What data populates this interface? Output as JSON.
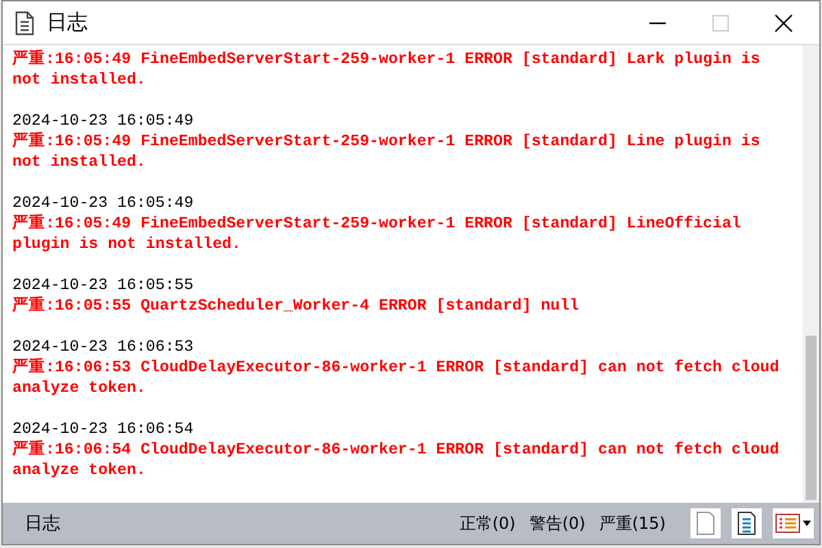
{
  "window": {
    "title": "日志"
  },
  "entries": [
    {
      "kind": "error",
      "message": "严重:16:05:49 FineEmbedServerStart-259-worker-1 ERROR [standard] Lark plugin is not installed."
    },
    {
      "date": "2024-10-23 16:05:49",
      "kind": "error",
      "message": "严重:16:05:49 FineEmbedServerStart-259-worker-1 ERROR [standard] Line plugin is not installed."
    },
    {
      "date": "2024-10-23 16:05:49",
      "kind": "error",
      "message": "严重:16:05:49 FineEmbedServerStart-259-worker-1 ERROR [standard] LineOfficial plugin is not installed."
    },
    {
      "date": "2024-10-23 16:05:55",
      "kind": "error",
      "message": "严重:16:05:55 QuartzScheduler_Worker-4 ERROR [standard] null"
    },
    {
      "date": "2024-10-23 16:06:53",
      "kind": "error",
      "message": "严重:16:06:53 CloudDelayExecutor-86-worker-1 ERROR [standard] can not fetch cloud analyze token."
    },
    {
      "date": "2024-10-23 16:06:54",
      "kind": "error",
      "message": "严重:16:06:54 CloudDelayExecutor-86-worker-1 ERROR [standard] can not fetch cloud analyze token."
    }
  ],
  "status_bar": {
    "label": "日志",
    "counts": [
      "正常(0)",
      "警告(0)",
      "严重(15)"
    ]
  }
}
